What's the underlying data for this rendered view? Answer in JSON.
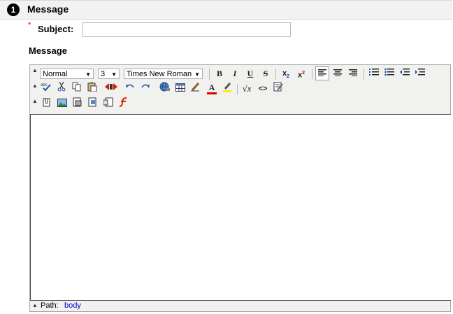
{
  "section": {
    "number": "1",
    "title": "Message"
  },
  "subject": {
    "required_mark": "*",
    "label": "Subject:",
    "value": ""
  },
  "message_label": "Message",
  "editor": {
    "format_select": "Normal",
    "size_select": "3",
    "font_select": "Times New Roman",
    "collapse_glyph": "▲",
    "dropdown_glyph": "▼",
    "buttons": {
      "bold": "B",
      "italic": "I",
      "underline": "U",
      "strike": "S",
      "font_color": "A",
      "subscript_base": "x",
      "subscript_mark": "2",
      "superscript_base": "x",
      "superscript_mark": "2",
      "equation": "√x",
      "html_source": "<>"
    },
    "content": "",
    "path_label": "Path:",
    "path_value": "body"
  }
}
